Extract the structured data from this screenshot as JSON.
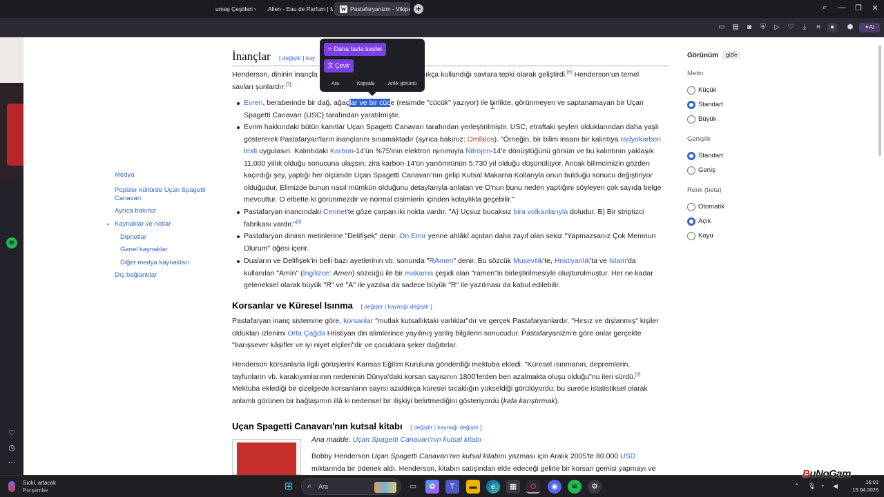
{
  "browser": {
    "tabs": [
      {
        "label": "umaş Çeşitleri ve |",
        "active": false
      },
      {
        "label": "Alien - Eau de Parfum | M",
        "active": false
      },
      {
        "label": "Pastafaryanizm - Vikipedi",
        "active": true,
        "favicon": "W"
      }
    ],
    "new_tab": "+"
  },
  "toc": {
    "items": [
      {
        "label": "Popüler kültürde Uçan Spagetti Canavarı"
      },
      {
        "label": "Ayrıca bakınız"
      },
      {
        "label": "Kaynaklar ve notlar"
      },
      {
        "label": "Dipnotlar"
      },
      {
        "label": "Genel kaynaklar"
      },
      {
        "label": "Diğer medya kaynakları"
      },
      {
        "label": "Dış bağlantılar"
      }
    ],
    "partial": "Medya"
  },
  "popup": {
    "explore": "Daha fazla keşfet",
    "translate": "Çevir",
    "actions": [
      "Ara",
      "Kopyala",
      "Anlık görüntü"
    ]
  },
  "article": {
    "sections": {
      "beliefs": {
        "title": "İnançlar",
        "edit": "değiştir",
        "edit2": "kay"
      },
      "pirates": {
        "title": "Korsanlar ve Küresel Isınma",
        "edit": "değiştir",
        "edit_source": "kaynağı değiştir"
      },
      "holy_book": {
        "title": "Uçan Spagetti Canavarı'nın kutsal kitabı",
        "edit": "değiştir",
        "edit_source": "kaynağı değiştir"
      }
    },
    "intro_a": "Henderson, dininin inançla",
    "intro_b": "sıkça kullandığı savlara tepki olarak geliştirdi.",
    "intro_c": "Henderson'un temel",
    "intro_d": "savları şunlardır:",
    "refs": {
      "r6": "[6]",
      "r7": "[7]",
      "r8": "[8]",
      "r9": "[9]"
    },
    "b1": {
      "link": "Evren",
      "t1": ", beraberinde bir dağ, ağaç",
      "sel": "lar ve bir cüc",
      "t2": "e (resimde \"cücük\" yazıyor) ile birlikte, görünmeyen ve saptanamayan bir Uçan",
      "t3": "Spagetti Canavarı (USC) tarafından yaratılmıştır."
    },
    "b2": {
      "l1": "Evrim hakkındaki bütün kanıtlar Uçan Spagetti Canavarı tarafından yerleştirilmiştir. USC, etraftaki şeyleri olduklarından daha yaşlı",
      "l2a": "göstererek Pastafaryan'ların inançlarını sınamaktadır (ayrıca bakınız: ",
      "omfalos": "Omfalos",
      "l2b": "). \"Örneğin, bir bilim insanı bir kalıntıya ",
      "radyokarbon": "radyokarbon",
      "testi": "testi",
      "l3a": " uygulasın. Kalıntıdaki ",
      "karbon": "Karbon",
      "l3b": "-14'ün %75'inin elektron ışınımıyla ",
      "nitrojen": "Nitrojen",
      "l3c": "-14'e dönüştüğünü görsün ve bu kalıntının yaklaşık",
      "l4": "11.000 yıllık olduğu sonucuna ulaşsın; zira karbon-14'ün yarıömrünün 5.730 yıl olduğu düşünülüyor. Ancak bilimcimizin gözden",
      "l5": "kaçırdığı şey, yaptığı her ölçümde Uçan Spagetti Canavarı'nın gelip Kutsal Makarna Kollarıyla onun bulduğu sonucu değiştiriyor",
      "l6": "olduğudur. Elimizde bunun nasıl mümkün olduğunu detaylarıyla anlatan ve O'nun bunu neden yaptığını söyleyen çok sayıda belge",
      "l7": "mevcuttur. O elbette ki görünmezdir ve normal cisimlerin içinden kolaylıkla geçebilir.\""
    },
    "b3": {
      "a": "Pastafaryan inancındaki ",
      "cennet": "Cennet",
      "b": "'te göze çarpan iki nokta vardır. \"A) Uçsuz bucaksız ",
      "volkan": "bira volkanlarıyla",
      "c": " doludur. B) Bir striptizci",
      "d": "fabrikası vardır.\""
    },
    "b4": {
      "a": "Pastafaryan dininin metinlerine \"Delifişek\" denir. ",
      "onemir": "On Emir",
      "b": " yerine ahlâkî açıdan daha zayıf olan sekiz \"Yapmazsanız Çok Memnun",
      "c": "Olurum\" öğesi içerir."
    },
    "b5": {
      "a": "Duaların ve Delifişek'in belli bazı ayetlerinin vb. sonunda \"",
      "ramen": "RAmen",
      "b": "\" denir. Bu sözcük ",
      "musevilik": "Musevilik",
      "c": "'te, ",
      "hristiyanlik": "Hristiyanlık",
      "d": "'ta ve ",
      "islam": "İslam",
      "e": "'da",
      "f": "kullanılan \"Amîn\" (",
      "ingilizce": "İngilizce",
      "g": ": ",
      "amen": "Amen",
      "h": ") sözcüğü ile bir ",
      "makarna": "makarna",
      "i": " çeşidi olan \"ramen\"in birleştirilmesiyle oluşturulmuştur. Her ne kadar",
      "j": "geleneksel olarak büyük \"R\" ve \"A\" ile yazılsa da sadece büyük \"R\" ile yazılması da kabul edilebilir."
    },
    "p1": {
      "a": "Pastafaryan inanç sistemine göre, ",
      "korsanlar": "korsanlar",
      "b": " \"mutlak kutsallıktaki varlıklar\"dır ve gerçek Pastafaryanlardır. \"Hırsız ve dışlanmış\" kişiler",
      "c": "oldukları izlenimi ",
      "ortacag": "Orta Çağda",
      "d": " Hristiyan din alimlerince yayılmış yanlış bilgilerin sonucudur. Pastafaryanizm'e göre onlar gerçekte",
      "e": "\"barışsever kâşifler ve iyi niyet elçileri\"dir ve çocuklara şeker dağıtırlar."
    },
    "p2": {
      "l1": "Henderson korsanlarla ilgili görüşlerini Kansas Eğitim Kuruluna gönderdiği mektuba ekledi. \"Küresel ısınmanın, depremlerin,",
      "l2": "tayfunların vb. karakıyımlarının nedeninin Dünya'daki korsan sayısının 1800'lerden beri azalmakta oluşu olduğu\"nu ileri sürdü.",
      "l3": "Mektuba eklediği bir çizelgede korsanların sayısı azaldıkça küresel sıcaklığın yükseldiği görülüyordu; bu suretle istatistiksel olarak",
      "l4a": "anlamlı görünen bir bağlaşımın illâ ki nedensel bir ilişkiyi belirtmediğini gösteriyordu (",
      "l4b": "kafa karıştırmak",
      "l4c": ")."
    },
    "main_article": {
      "prefix": "Ana madde: ",
      "link": "Uçan Spagetti Canavarı'nın kutsal kitabı"
    },
    "p3": {
      "a": "Bobby Henderson ",
      "it": "Uçan Spagetti Canavarı'nın kutsal kitabı",
      "b": "nı yazması için Aralık 2005'te 80.000 ",
      "usd": "USD",
      "c": "miktarında bir ödenek aldı. Henderson, kitabın satışından elde edeceği gelirle bir korsan gemisi yapmayı ve"
    }
  },
  "appearance": {
    "title": "Görünüm",
    "hide": "gizle",
    "text_head": "Metin",
    "text_options": [
      "Küçük",
      "Standart",
      "Büyük"
    ],
    "text_selected": 1,
    "width_head": "Genişlik",
    "width_options": [
      "Standart",
      "Geniş"
    ],
    "width_selected": 0,
    "color_head": "Renk (beta)",
    "color_options": [
      "Otomatik",
      "Açık",
      "Koyu"
    ],
    "color_selected": 1
  },
  "taskbar": {
    "weather_line1": "Sıckl. artacak",
    "weather_line2": "Perşembe",
    "search": "Ara",
    "time": "16:01",
    "date": "15.04.2026"
  },
  "watermark": {
    "b": "B",
    "rest": "uNoGam"
  }
}
